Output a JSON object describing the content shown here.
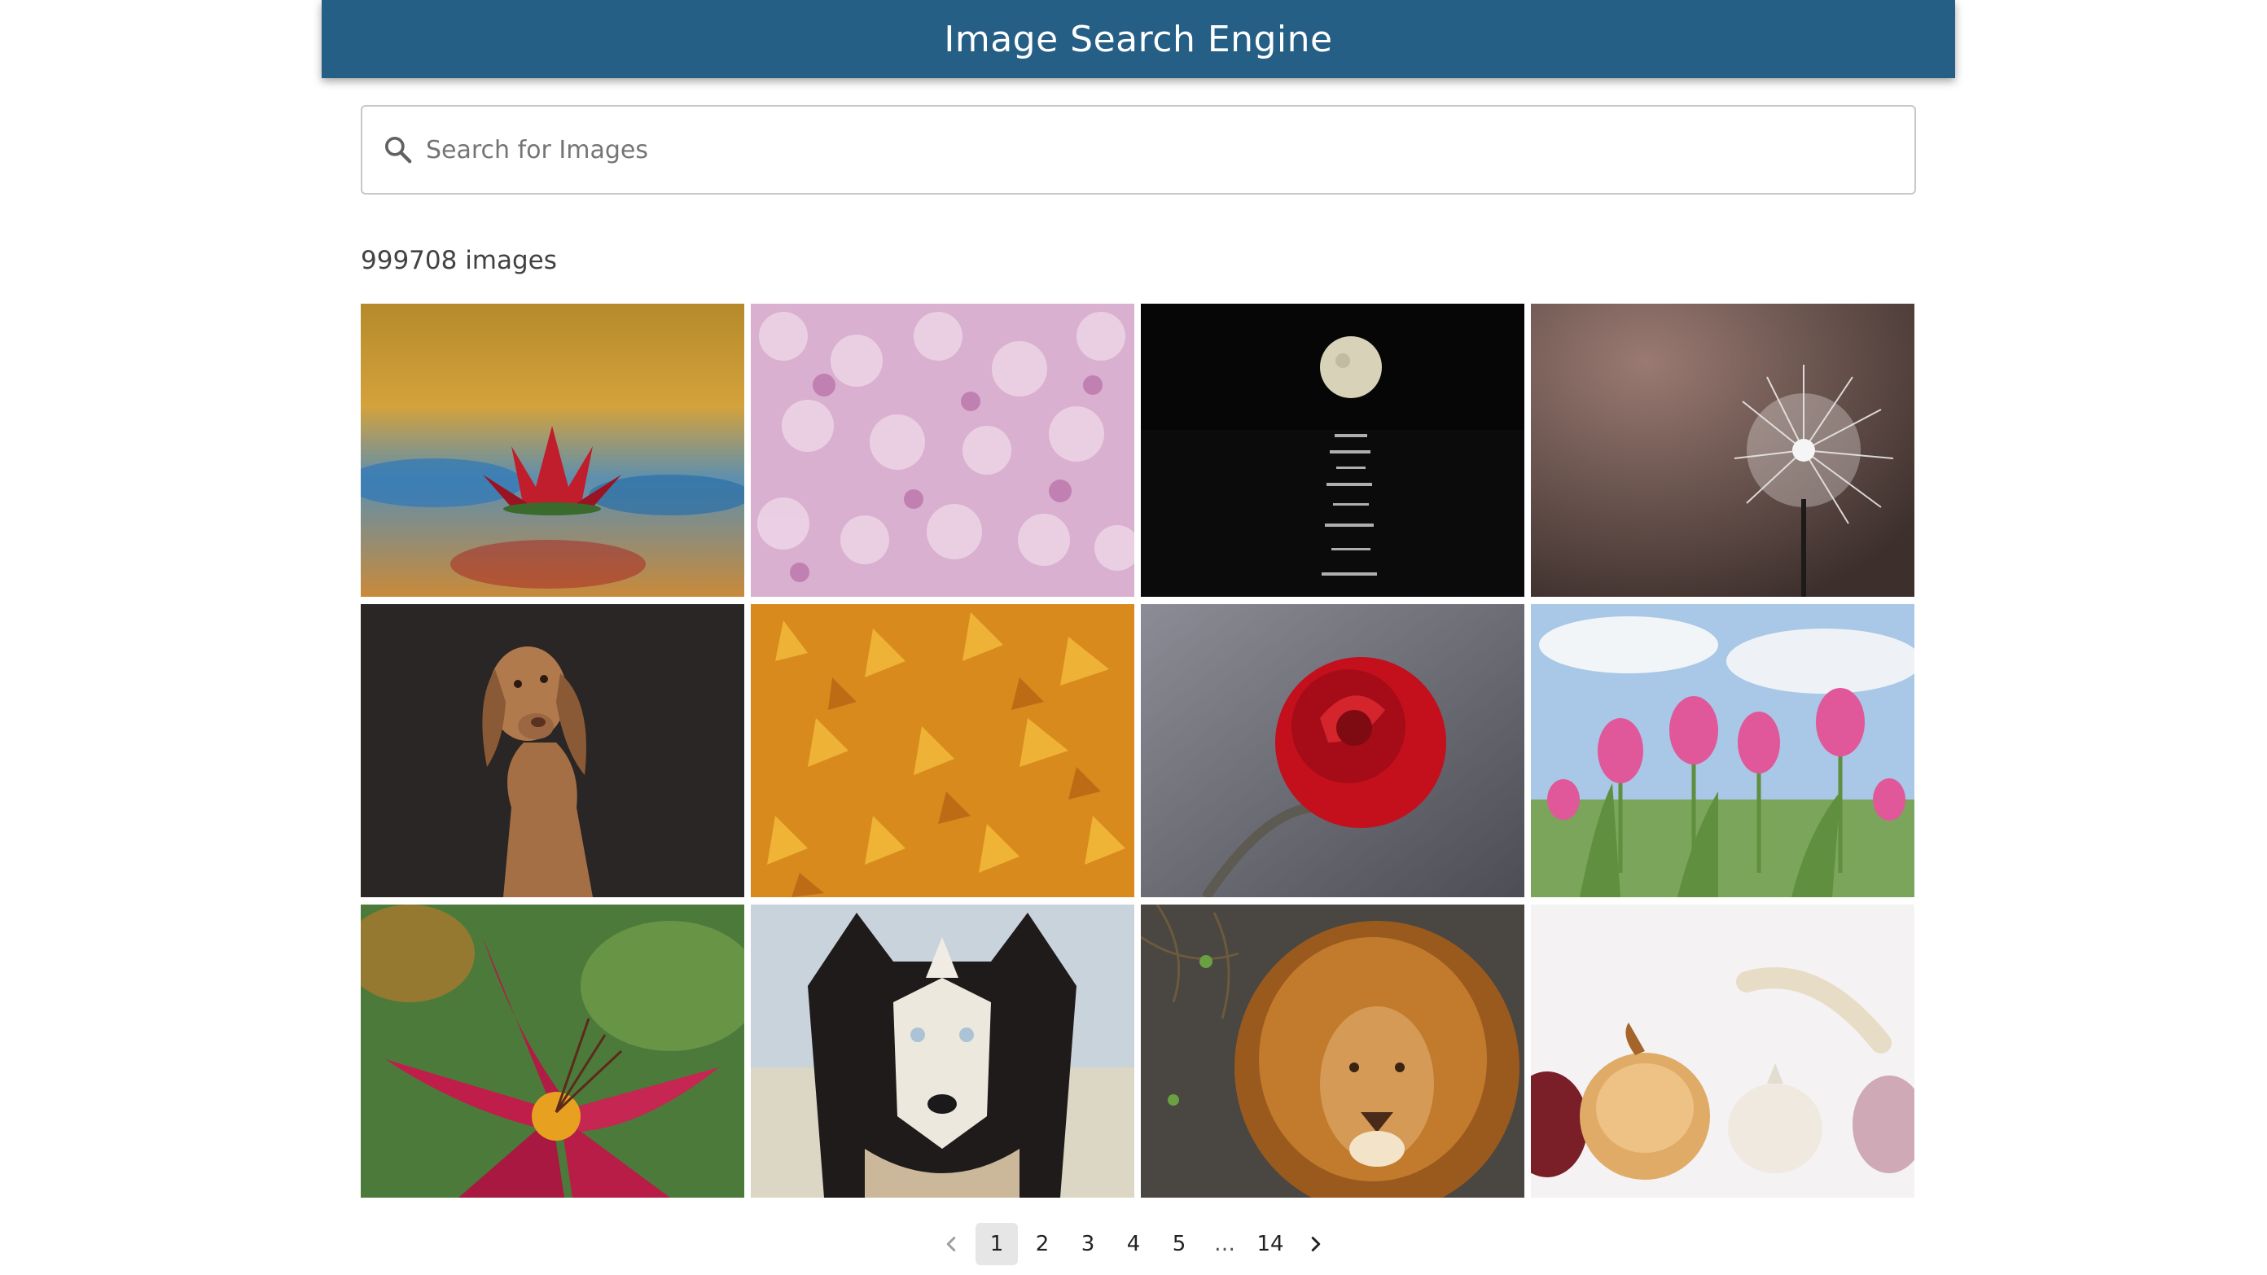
{
  "header": {
    "title": "Image Search Engine"
  },
  "search": {
    "placeholder": "Search for Images",
    "value": "",
    "icon": "search-icon"
  },
  "results": {
    "count_text": "999708 images",
    "images": [
      "red water lily",
      "pink hydrangea blossoms",
      "moon over sea",
      "dandelion seed head",
      "brown vizsla dog",
      "autumn maple leaves",
      "red rose",
      "pink tulips",
      "red lily with raindrops",
      "husky dog",
      "lion",
      "onion and garlic"
    ]
  },
  "pagination": {
    "prev_icon": "chevron-left-icon",
    "next_icon": "chevron-right-icon",
    "pages": [
      "1",
      "2",
      "3",
      "4",
      "5",
      "…",
      "14"
    ],
    "current": "1"
  },
  "colors": {
    "header": "#265f86",
    "active_page": "#e6e6e6"
  }
}
